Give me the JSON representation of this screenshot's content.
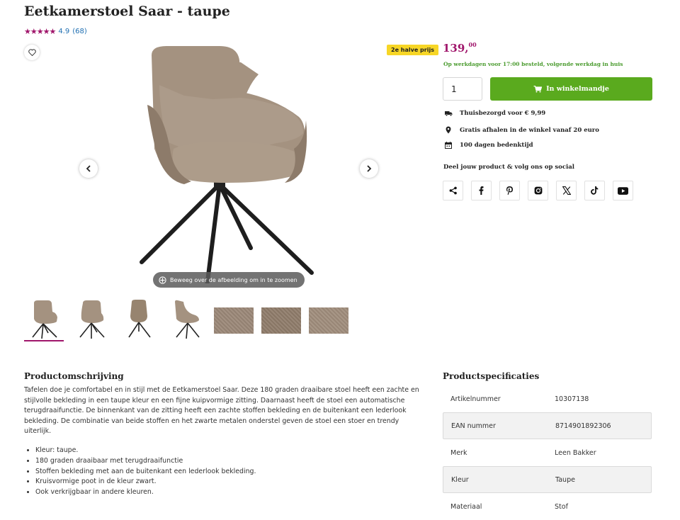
{
  "product": {
    "title": "Eetkamerstoel Saar - taupe",
    "rating": {
      "stars": "★★★★★",
      "score": "4.9",
      "count": "(68)"
    }
  },
  "gallery": {
    "zoom_hint": "Beweeg over de afbeelding om in te zoomen",
    "thumbnail_count": 7,
    "active_thumbnail": 1
  },
  "offer": {
    "badge": "2e halve prijs",
    "price_main": "139,",
    "price_cents": "00",
    "delivery_note": "Op werkdagen voor 17:00 besteld, volgende werkdag in huis",
    "quantity": "1",
    "cart_label": "In winkelmandje"
  },
  "usps": [
    {
      "icon": "truck-icon",
      "text": "Thuisbezorgd voor € 9,99"
    },
    {
      "icon": "location-pin-icon",
      "text": "Gratis afhalen in de winkel vanaf 20 euro"
    },
    {
      "icon": "calendar-icon",
      "text": "100 dagen bedenktijd"
    }
  ],
  "share": {
    "title": "Deel jouw product & volg ons op social",
    "icons": [
      "share-icon",
      "facebook-icon",
      "pinterest-icon",
      "instagram-icon",
      "x-icon",
      "tiktok-icon",
      "youtube-icon"
    ]
  },
  "description": {
    "heading": "Productomschrijving",
    "text": "Tafelen doe je comfortabel en in stijl met de Eetkamerstoel Saar. Deze 180 graden draaibare stoel heeft een zachte en stijlvolle bekleding in een taupe kleur en een fijne kuipvormige zitting. Daarnaast heeft de stoel een automatische terugdraaifunctie. De binnenkant van de zitting heeft een zachte stoffen bekleding en de buitenkant een lederlook bekleding. De combinatie van beide stoffen en het zwarte metalen onderstel geven de stoel een stoer en trendy uiterlijk.",
    "bullets": [
      "Kleur: taupe.",
      "180 graden draaibaar met terugdraaifunctie",
      "Stoffen bekleding met aan de buitenkant een lederlook bekleding.",
      "Kruisvormige poot in de kleur zwart.",
      "Ook verkrijgbaar in andere kleuren."
    ]
  },
  "specs": {
    "heading": "Productspecificaties",
    "rows": [
      {
        "label": "Artikelnummer",
        "value": "10307138"
      },
      {
        "label": "EAN nummer",
        "value": "8714901892306"
      },
      {
        "label": "Merk",
        "value": "Leen Bakker"
      },
      {
        "label": "Kleur",
        "value": "Taupe"
      },
      {
        "label": "Materiaal",
        "value": "Stof"
      }
    ]
  },
  "colors": {
    "brand": "#a0166b",
    "green": "#5aaa1e",
    "badge": "#f7d626",
    "chair": "#a49280"
  }
}
